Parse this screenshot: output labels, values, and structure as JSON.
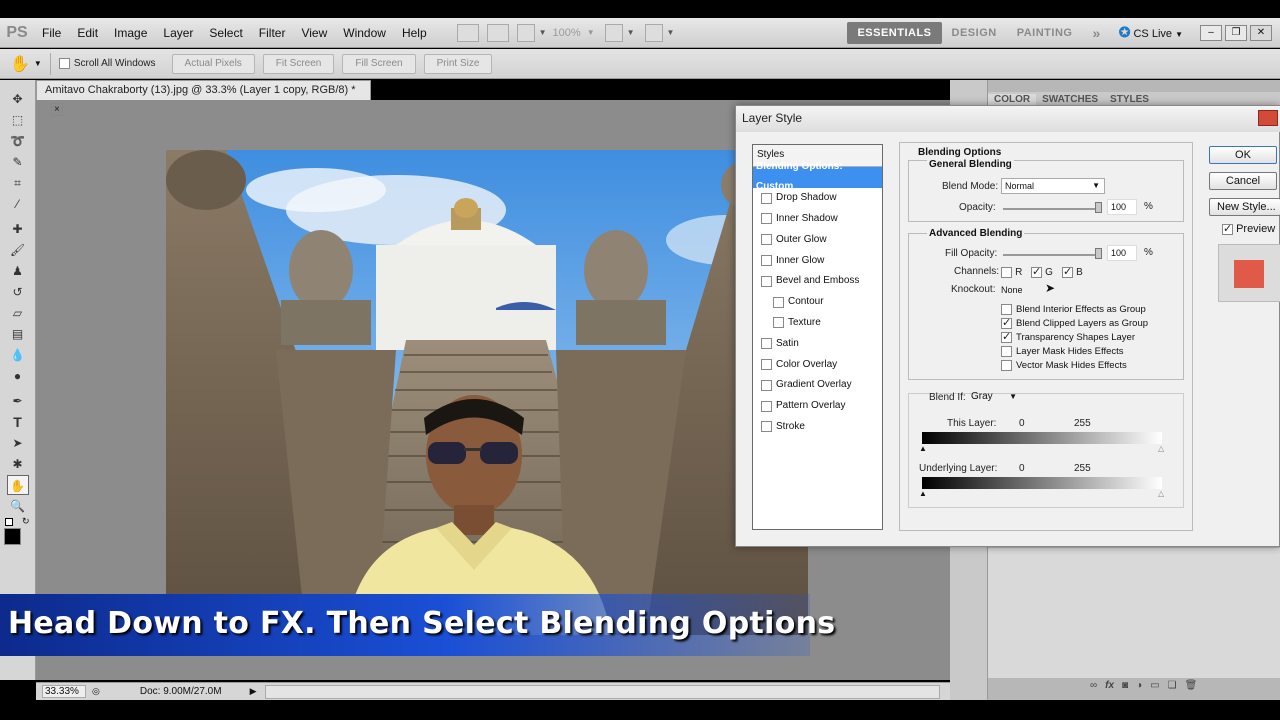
{
  "app": {
    "logo": "PS",
    "menu": [
      "File",
      "Edit",
      "Image",
      "Layer",
      "Select",
      "Filter",
      "View",
      "Window",
      "Help"
    ],
    "zoom_display": "100%",
    "workspaces": [
      "ESSENTIALS",
      "DESIGN",
      "PAINTING"
    ],
    "workspace_more": "»",
    "cs_live": "CS Live"
  },
  "options_bar": {
    "scroll_all_windows": "Scroll All Windows",
    "buttons": [
      "Actual Pixels",
      "Fit Screen",
      "Fill Screen",
      "Print Size"
    ]
  },
  "document": {
    "tab_title": "Amitavo Chakraborty (13).jpg @ 33.3% (Layer 1 copy, RGB/8) *",
    "close": "×"
  },
  "status": {
    "zoom": "33.33%",
    "doc_size": "Doc: 9.00M/27.0M"
  },
  "right_panel": {
    "tabs": [
      "COLOR",
      "SWATCHES",
      "STYLES"
    ]
  },
  "caption": "Head Down to FX. Then Select Blending Options",
  "layer_style": {
    "title": "Layer Style",
    "styles_header": "Styles",
    "styles": [
      {
        "label": "Blending Options: Custom",
        "selected": true,
        "checkbox": false
      },
      {
        "label": "Drop Shadow",
        "checkbox": true
      },
      {
        "label": "Inner Shadow",
        "checkbox": true
      },
      {
        "label": "Outer Glow",
        "checkbox": true
      },
      {
        "label": "Inner Glow",
        "checkbox": true
      },
      {
        "label": "Bevel and Emboss",
        "checkbox": true
      },
      {
        "label": "Contour",
        "checkbox": true,
        "sub": true
      },
      {
        "label": "Texture",
        "checkbox": true,
        "sub": true
      },
      {
        "label": "Satin",
        "checkbox": true
      },
      {
        "label": "Color Overlay",
        "checkbox": true
      },
      {
        "label": "Gradient Overlay",
        "checkbox": true
      },
      {
        "label": "Pattern Overlay",
        "checkbox": true
      },
      {
        "label": "Stroke",
        "checkbox": true
      }
    ],
    "blending_options": {
      "title": "Blending Options",
      "general": "General Blending",
      "blend_mode_label": "Blend Mode:",
      "blend_mode_value": "Normal",
      "opacity_label": "Opacity:",
      "opacity_value": "100",
      "percent": "%",
      "advanced": "Advanced Blending",
      "fill_opacity_label": "Fill Opacity:",
      "fill_opacity_value": "100",
      "channels_label": "Channels:",
      "channels": [
        {
          "name": "R",
          "checked": false
        },
        {
          "name": "G",
          "checked": true
        },
        {
          "name": "B",
          "checked": true
        }
      ],
      "knockout_label": "Knockout:",
      "knockout_value": "None",
      "options": [
        {
          "label": "Blend Interior Effects as Group",
          "checked": false
        },
        {
          "label": "Blend Clipped Layers as Group",
          "checked": true
        },
        {
          "label": "Transparency Shapes Layer",
          "checked": true
        },
        {
          "label": "Layer Mask Hides Effects",
          "checked": false
        },
        {
          "label": "Vector Mask Hides Effects",
          "checked": false
        }
      ],
      "blend_if_label": "Blend If:",
      "blend_if_value": "Gray",
      "this_layer_label": "This Layer:",
      "this_layer_min": "0",
      "this_layer_max": "255",
      "underlying_label": "Underlying Layer:",
      "underlying_min": "0",
      "underlying_max": "255"
    },
    "buttons": {
      "ok": "OK",
      "cancel": "Cancel",
      "new_style": "New Style...",
      "preview": "Preview"
    },
    "preview_color": "#e05a4a"
  }
}
